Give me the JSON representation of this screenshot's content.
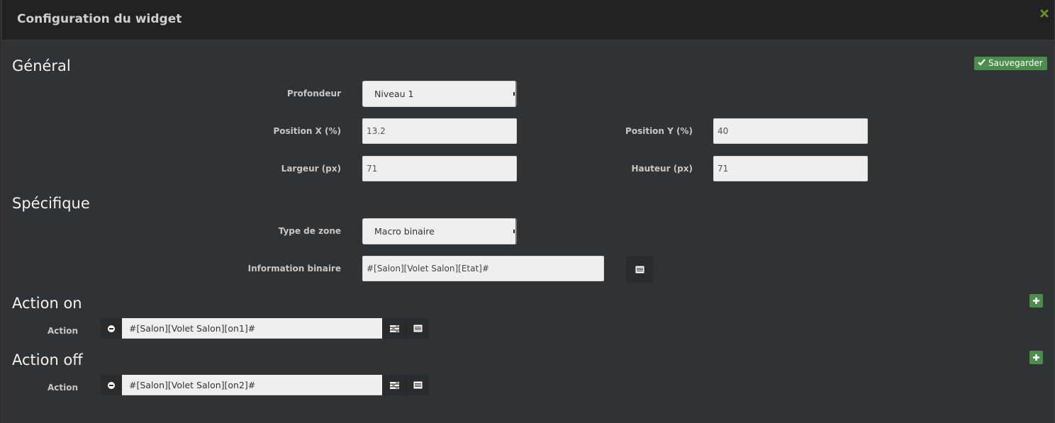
{
  "modal": {
    "title": "Configuration du widget",
    "close_icon": "close-icon"
  },
  "toolbar": {
    "save_label": "Sauvegarder",
    "save_icon": "check-icon"
  },
  "colors": {
    "accent_green": "#4c8c4c",
    "header_bg": "#212121",
    "body_bg": "#313234",
    "input_bg": "#efefef"
  },
  "general": {
    "heading": "Général",
    "depth": {
      "label": "Profondeur",
      "value": "Niveau 1"
    },
    "pos_x": {
      "label": "Position X (%)",
      "value": "13.2"
    },
    "pos_y": {
      "label": "Position Y (%)",
      "value": "40"
    },
    "width": {
      "label": "Largeur (px)",
      "value": "71"
    },
    "height": {
      "label": "Hauteur (px)",
      "value": "71"
    }
  },
  "specific": {
    "heading": "Spécifique",
    "zone_type": {
      "label": "Type de zone",
      "value": "Macro binaire"
    },
    "binary_info": {
      "label": "Information binaire",
      "value": "#[Salon][Volet Salon][Etat]#",
      "button_icon": "list-icon"
    }
  },
  "action_on": {
    "heading": "Action on",
    "add_icon": "plus-icon",
    "actions": [
      {
        "label": "Action",
        "value": "#[Salon][Volet Salon][on1]#"
      }
    ]
  },
  "action_off": {
    "heading": "Action off",
    "add_icon": "plus-icon",
    "actions": [
      {
        "label": "Action",
        "value": "#[Salon][Volet Salon][on2]#"
      }
    ]
  }
}
